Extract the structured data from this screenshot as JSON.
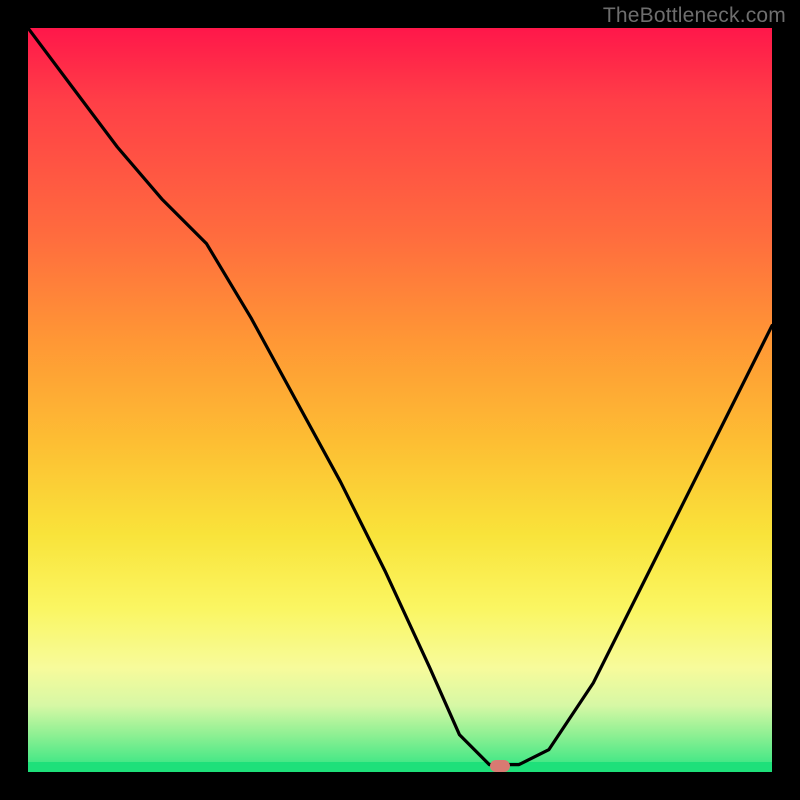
{
  "watermark": "TheBottleneck.com",
  "marker": {
    "x_pct": 63.5,
    "y_pct": 99.2,
    "color": "#d87a72"
  },
  "chart_data": {
    "type": "line",
    "title": "",
    "xlabel": "",
    "ylabel": "",
    "xlim": [
      0,
      100
    ],
    "ylim": [
      0,
      100
    ],
    "grid": false,
    "legend": false,
    "note": "x = horizontal position (% of plot width, 0 left → 100 right); y = bottleneck percentage (0 at bottom/green → 100 at top/red). Values estimated from pixel positions.",
    "series": [
      {
        "name": "bottleneck-curve",
        "x": [
          0,
          6,
          12,
          18,
          24,
          30,
          36,
          42,
          48,
          54,
          58,
          62,
          66,
          70,
          76,
          82,
          88,
          94,
          100
        ],
        "y": [
          100,
          92,
          84,
          77,
          71,
          61,
          50,
          39,
          27,
          14,
          5,
          1,
          1,
          3,
          12,
          24,
          36,
          48,
          60
        ]
      }
    ],
    "optimum_marker": {
      "x": 63.5,
      "y": 0.8
    }
  }
}
